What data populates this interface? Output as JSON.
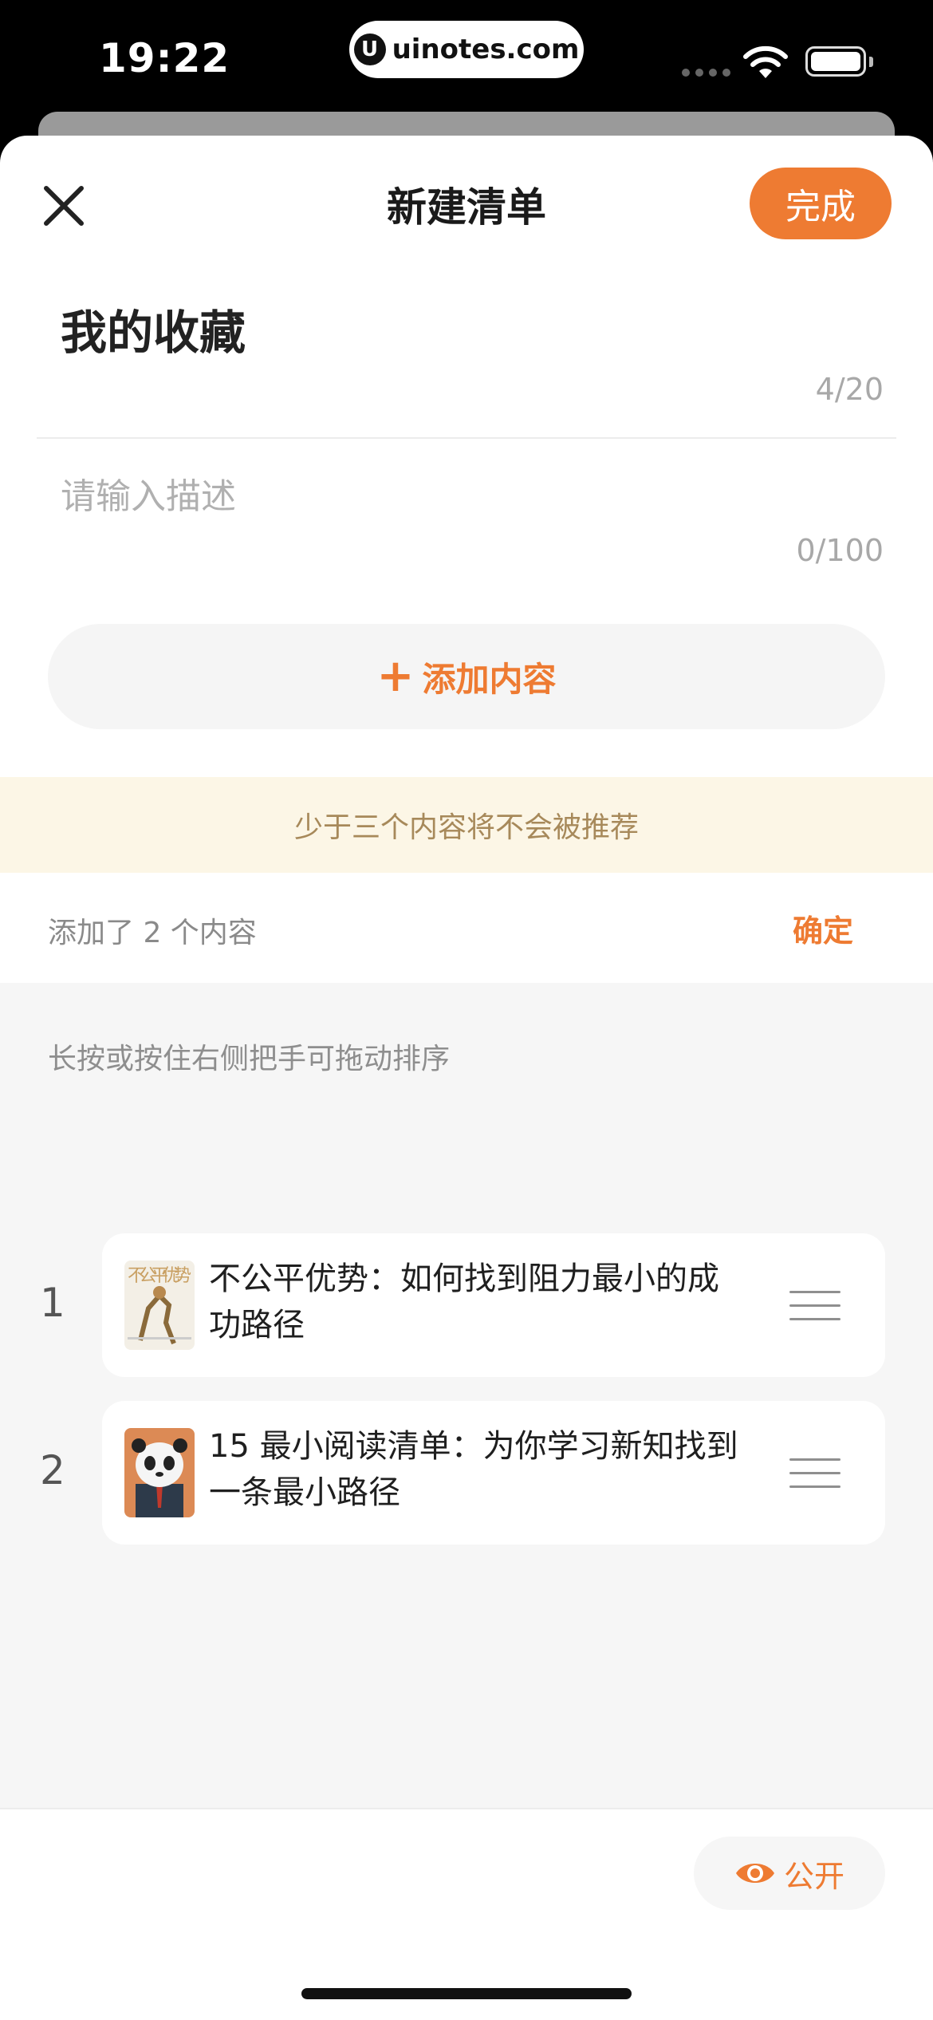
{
  "status_bar": {
    "time": "19:22",
    "url": "uinotes.com",
    "url_logo": "U"
  },
  "nav": {
    "title": "新建清单",
    "done_label": "完成"
  },
  "form": {
    "title_value": "我的收藏",
    "title_count": "4/20",
    "description_placeholder": "请输入描述",
    "description_count": "0/100",
    "add_content_label": "添加内容"
  },
  "notice": "少于三个内容将不会被推荐",
  "added": {
    "text": "添加了 2 个内容",
    "confirm_label": "确定"
  },
  "list": {
    "hint": "长按或按住右侧把手可拖动排序",
    "items": [
      {
        "index": "1",
        "title": "不公平优势：如何找到阻力最小的成功路径",
        "cover_text": "不公平优势"
      },
      {
        "index": "2",
        "title": "15 最小阅读清单：为你学习新知找到一条最小路径"
      }
    ]
  },
  "bottom": {
    "public_label": "公开"
  },
  "colors": {
    "accent": "#ee7b32",
    "notice_bg": "#fcf6e6",
    "notice_text": "#a7895a"
  },
  "icons": {
    "close": "close-icon",
    "plus": "plus-icon",
    "drag": "drag-handle-icon",
    "eye": "eye-icon"
  }
}
